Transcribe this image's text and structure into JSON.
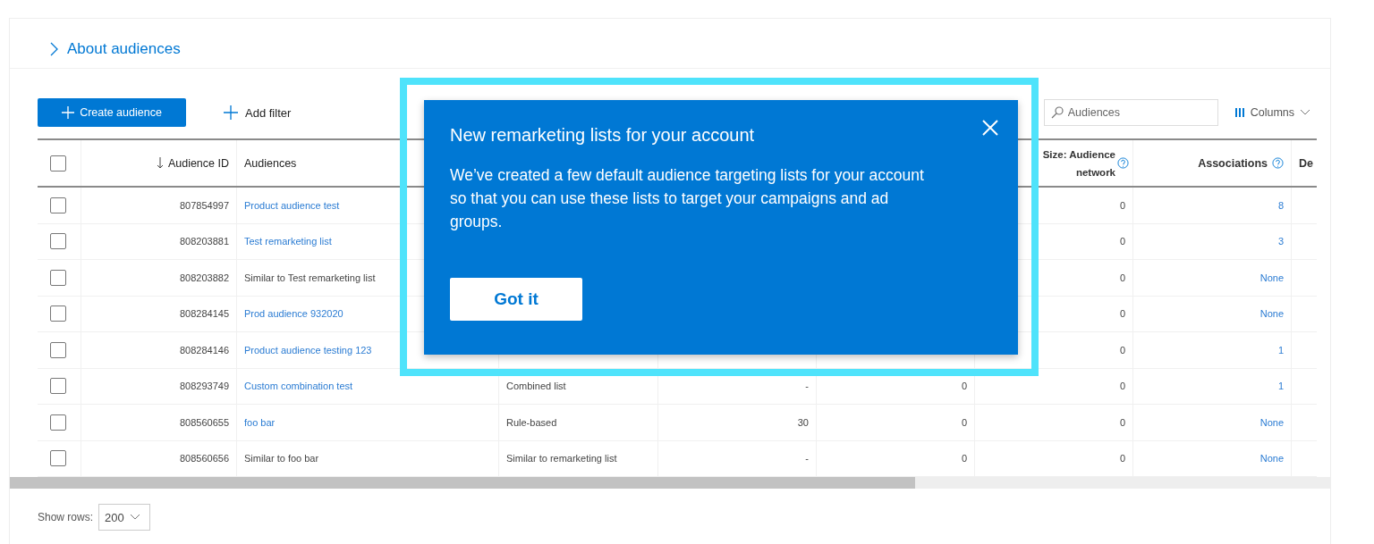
{
  "about_link": "About audiences",
  "toolbar": {
    "create_button": "Create audience",
    "filter_button": "Add filter",
    "search": {
      "placeholder": "Audiences"
    },
    "columns_button": "Columns"
  },
  "table": {
    "header_checkbox": {
      "checked": false
    },
    "columns": [
      {
        "label": "Audience ID",
        "sorted": true
      },
      {
        "label": "Audiences"
      },
      null,
      null,
      null,
      {
        "label": "Size: Audience network",
        "help": true
      },
      {
        "label": "Associations",
        "help": true
      },
      {
        "label": "De"
      }
    ],
    "rows": [
      {
        "checked": false,
        "id": "807854997",
        "name": "Product audience test",
        "link": true,
        "cells": [
          null,
          null,
          null,
          "0",
          "8"
        ]
      },
      {
        "checked": false,
        "id": "808203881",
        "name": "Test remarketing list",
        "link": true,
        "cells": [
          null,
          null,
          null,
          "0",
          "3"
        ]
      },
      {
        "checked": false,
        "id": "808203882",
        "name": "Similar to Test remarketing list",
        "link": false,
        "cells": [
          null,
          null,
          null,
          "0",
          "None"
        ]
      },
      {
        "checked": false,
        "id": "808284145",
        "name": "Prod audience 932020",
        "link": true,
        "cells": [
          null,
          null,
          null,
          "0",
          "None"
        ]
      },
      {
        "checked": false,
        "id": "808284146",
        "name": "Product audience testing 123",
        "link": true,
        "cells": [
          null,
          null,
          null,
          "0",
          "1"
        ]
      },
      {
        "checked": false,
        "id": "808293749",
        "name": "Custom combination test",
        "link": true,
        "cells": [
          "Combined list",
          "-",
          "0",
          "0",
          "1"
        ]
      },
      {
        "checked": false,
        "id": "808560655",
        "name": "foo bar",
        "link": true,
        "cells": [
          "Rule-based",
          "30",
          "0",
          "0",
          "None"
        ]
      },
      {
        "checked": false,
        "id": "808560656",
        "name": "Similar to foo bar",
        "link": false,
        "cells": [
          "Similar to remarketing list",
          "-",
          "0",
          "0",
          "None"
        ]
      }
    ]
  },
  "footer": {
    "label": "Show rows:",
    "value": "200"
  },
  "callout": {
    "title": "New remarketing lists for your account",
    "body": "We’ve created a few default audience targeting lists for your account so that you can use these lists to target your campaigns and ad groups.",
    "button": "Got it"
  }
}
